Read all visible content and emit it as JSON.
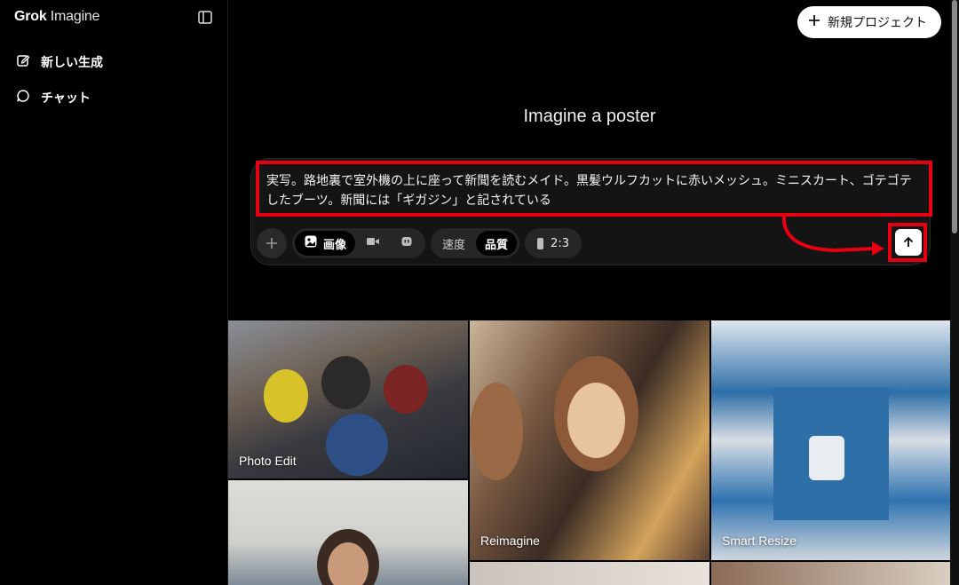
{
  "sidebar": {
    "logo_bold": "Grok",
    "logo_light": "Imagine",
    "items": [
      {
        "label": "新しい生成",
        "icon": "edit-icon"
      },
      {
        "label": "チャット",
        "icon": "chat-bubble-icon"
      }
    ]
  },
  "header": {
    "new_project_label": "新規プロジェクト",
    "title": "Imagine a poster"
  },
  "composer": {
    "prompt_text": "実写。路地裏で室外機の上に座って新聞を読むメイド。黒髪ウルフカットに赤いメッシュ。ミニスカート、ゴテゴテしたブーツ。新聞には「ギガジン」と記されている",
    "mode_options": [
      {
        "label": "画像",
        "icon": "image-icon",
        "selected": true
      },
      {
        "label": "",
        "icon": "video-icon",
        "selected": false
      },
      {
        "label": "",
        "icon": "robot-icon",
        "selected": false
      }
    ],
    "speed_label": "速度",
    "quality_label": "品質",
    "quality_selected": "品質",
    "aspect_ratio": "2:3"
  },
  "gallery": {
    "tiles": [
      {
        "label": "Photo Edit"
      },
      {
        "label": "Reimagine"
      },
      {
        "label": "Smart Resize"
      }
    ]
  },
  "colors": {
    "background": "#000000",
    "annotation_red": "#e60012",
    "button_white": "#ffffff"
  }
}
